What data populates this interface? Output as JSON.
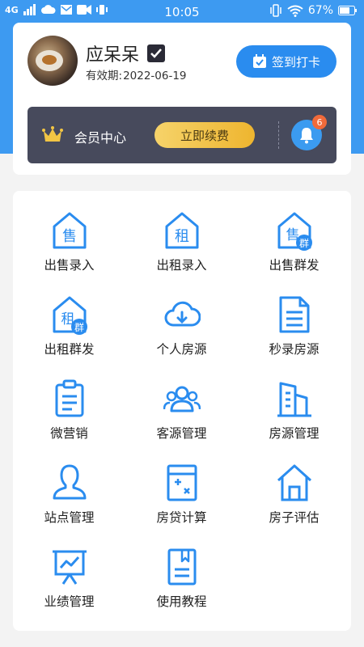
{
  "status_bar": {
    "network": "4G",
    "time": "10:05",
    "battery": "67%"
  },
  "profile": {
    "name": "应呆呆",
    "expiry_label": "有效期:",
    "expiry_date": "2022-06-19",
    "checkin_button": "签到打卡"
  },
  "member": {
    "label": "会员中心",
    "renew_button": "立即续费",
    "notification_count": "6"
  },
  "grid": {
    "items": [
      {
        "label": "出售录入",
        "icon": "house-sell-icon",
        "char": "售"
      },
      {
        "label": "出租录入",
        "icon": "house-rent-icon",
        "char": "租"
      },
      {
        "label": "出售群发",
        "icon": "house-sell-group-icon",
        "char": "售",
        "badge": "群"
      },
      {
        "label": "出租群发",
        "icon": "house-rent-group-icon",
        "char": "租",
        "badge": "群"
      },
      {
        "label": "个人房源",
        "icon": "cloud-download-icon"
      },
      {
        "label": "秒录房源",
        "icon": "document-icon"
      },
      {
        "label": "微营销",
        "icon": "clipboard-icon"
      },
      {
        "label": "客源管理",
        "icon": "users-icon"
      },
      {
        "label": "房源管理",
        "icon": "buildings-icon"
      },
      {
        "label": "站点管理",
        "icon": "person-icon"
      },
      {
        "label": "房贷计算",
        "icon": "calculator-icon"
      },
      {
        "label": "房子评估",
        "icon": "home-icon"
      },
      {
        "label": "业绩管理",
        "icon": "chart-board-icon"
      },
      {
        "label": "使用教程",
        "icon": "book-icon"
      }
    ]
  },
  "colors": {
    "brand_blue": "#3d9af1",
    "icon_blue": "#2a8cef",
    "member_bar": "#474a5c",
    "renew_gold": "#eeb52f"
  }
}
